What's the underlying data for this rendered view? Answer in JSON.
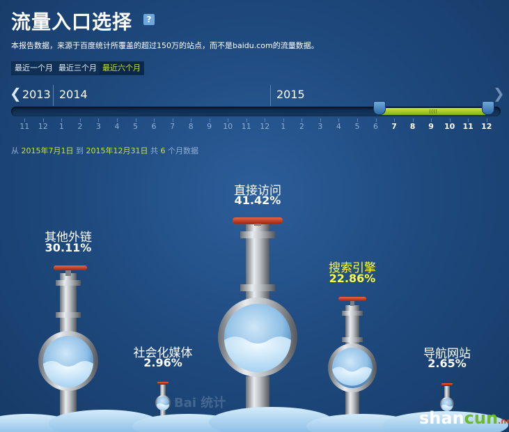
{
  "header": {
    "title": "流量入口选择",
    "help_icon": "?",
    "description": "本报告数据，来源于百度统计所覆盖的超过150万的站点，而不是baidu.com的流量数据。"
  },
  "range_buttons": [
    {
      "label": "最近一个月",
      "selected": false
    },
    {
      "label": "最近三个月",
      "selected": false
    },
    {
      "label": "最近六个月",
      "selected": true
    }
  ],
  "timeline": {
    "years": [
      "2013",
      "2014",
      "2015"
    ],
    "months": [
      "11",
      "12",
      "1",
      "2",
      "3",
      "4",
      "5",
      "6",
      "7",
      "8",
      "9",
      "10",
      "11",
      "12",
      "1",
      "2",
      "3",
      "4",
      "5",
      "6",
      "7",
      "8",
      "9",
      "10",
      "11",
      "12"
    ],
    "selected_start_index": 20,
    "selected_end_index": 25
  },
  "period": {
    "prefix": "从",
    "start": "2015年7月1日",
    "mid": "到",
    "end": "2015年12月31日",
    "count_prefix": "共",
    "count": "6",
    "count_suffix": "个月数据"
  },
  "channels": [
    {
      "name": "其他外链",
      "percent": "30.11%",
      "value": 30.11,
      "highlight": false
    },
    {
      "name": "社会化媒体",
      "percent": "2.96%",
      "value": 2.96,
      "highlight": false
    },
    {
      "name": "直接访问",
      "percent": "41.42%",
      "value": 41.42,
      "highlight": false
    },
    {
      "name": "搜索引擎",
      "percent": "22.86%",
      "value": 22.86,
      "highlight": true
    },
    {
      "name": "导航网站",
      "percent": "2.65%",
      "value": 2.65,
      "highlight": false
    }
  ],
  "watermark": "Bai 统计",
  "site_logo": {
    "shan": "shan",
    "cun": "cun",
    "suffix": ".net"
  },
  "colors": {
    "accent_green": "#c9e629",
    "highlight_yellow": "#ffff33",
    "valve_red": "#c8331b"
  }
}
